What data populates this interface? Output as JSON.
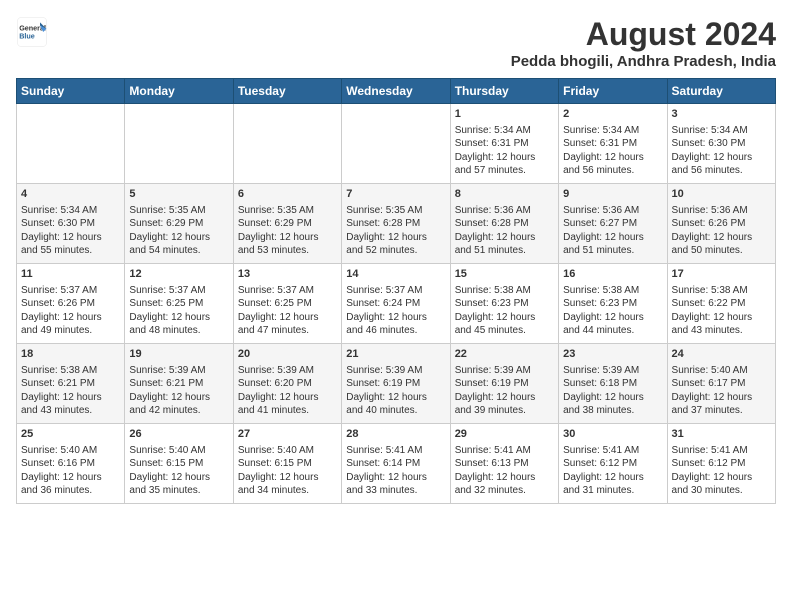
{
  "header": {
    "logo_line1": "General",
    "logo_line2": "Blue",
    "title": "August 2024",
    "subtitle": "Pedda bhogili, Andhra Pradesh, India"
  },
  "days_of_week": [
    "Sunday",
    "Monday",
    "Tuesday",
    "Wednesday",
    "Thursday",
    "Friday",
    "Saturday"
  ],
  "weeks": [
    [
      {
        "day": "",
        "info": ""
      },
      {
        "day": "",
        "info": ""
      },
      {
        "day": "",
        "info": ""
      },
      {
        "day": "",
        "info": ""
      },
      {
        "day": "1",
        "info": "Sunrise: 5:34 AM\nSunset: 6:31 PM\nDaylight: 12 hours\nand 57 minutes."
      },
      {
        "day": "2",
        "info": "Sunrise: 5:34 AM\nSunset: 6:31 PM\nDaylight: 12 hours\nand 56 minutes."
      },
      {
        "day": "3",
        "info": "Sunrise: 5:34 AM\nSunset: 6:30 PM\nDaylight: 12 hours\nand 56 minutes."
      }
    ],
    [
      {
        "day": "4",
        "info": "Sunrise: 5:34 AM\nSunset: 6:30 PM\nDaylight: 12 hours\nand 55 minutes."
      },
      {
        "day": "5",
        "info": "Sunrise: 5:35 AM\nSunset: 6:29 PM\nDaylight: 12 hours\nand 54 minutes."
      },
      {
        "day": "6",
        "info": "Sunrise: 5:35 AM\nSunset: 6:29 PM\nDaylight: 12 hours\nand 53 minutes."
      },
      {
        "day": "7",
        "info": "Sunrise: 5:35 AM\nSunset: 6:28 PM\nDaylight: 12 hours\nand 52 minutes."
      },
      {
        "day": "8",
        "info": "Sunrise: 5:36 AM\nSunset: 6:28 PM\nDaylight: 12 hours\nand 51 minutes."
      },
      {
        "day": "9",
        "info": "Sunrise: 5:36 AM\nSunset: 6:27 PM\nDaylight: 12 hours\nand 51 minutes."
      },
      {
        "day": "10",
        "info": "Sunrise: 5:36 AM\nSunset: 6:26 PM\nDaylight: 12 hours\nand 50 minutes."
      }
    ],
    [
      {
        "day": "11",
        "info": "Sunrise: 5:37 AM\nSunset: 6:26 PM\nDaylight: 12 hours\nand 49 minutes."
      },
      {
        "day": "12",
        "info": "Sunrise: 5:37 AM\nSunset: 6:25 PM\nDaylight: 12 hours\nand 48 minutes."
      },
      {
        "day": "13",
        "info": "Sunrise: 5:37 AM\nSunset: 6:25 PM\nDaylight: 12 hours\nand 47 minutes."
      },
      {
        "day": "14",
        "info": "Sunrise: 5:37 AM\nSunset: 6:24 PM\nDaylight: 12 hours\nand 46 minutes."
      },
      {
        "day": "15",
        "info": "Sunrise: 5:38 AM\nSunset: 6:23 PM\nDaylight: 12 hours\nand 45 minutes."
      },
      {
        "day": "16",
        "info": "Sunrise: 5:38 AM\nSunset: 6:23 PM\nDaylight: 12 hours\nand 44 minutes."
      },
      {
        "day": "17",
        "info": "Sunrise: 5:38 AM\nSunset: 6:22 PM\nDaylight: 12 hours\nand 43 minutes."
      }
    ],
    [
      {
        "day": "18",
        "info": "Sunrise: 5:38 AM\nSunset: 6:21 PM\nDaylight: 12 hours\nand 43 minutes."
      },
      {
        "day": "19",
        "info": "Sunrise: 5:39 AM\nSunset: 6:21 PM\nDaylight: 12 hours\nand 42 minutes."
      },
      {
        "day": "20",
        "info": "Sunrise: 5:39 AM\nSunset: 6:20 PM\nDaylight: 12 hours\nand 41 minutes."
      },
      {
        "day": "21",
        "info": "Sunrise: 5:39 AM\nSunset: 6:19 PM\nDaylight: 12 hours\nand 40 minutes."
      },
      {
        "day": "22",
        "info": "Sunrise: 5:39 AM\nSunset: 6:19 PM\nDaylight: 12 hours\nand 39 minutes."
      },
      {
        "day": "23",
        "info": "Sunrise: 5:39 AM\nSunset: 6:18 PM\nDaylight: 12 hours\nand 38 minutes."
      },
      {
        "day": "24",
        "info": "Sunrise: 5:40 AM\nSunset: 6:17 PM\nDaylight: 12 hours\nand 37 minutes."
      }
    ],
    [
      {
        "day": "25",
        "info": "Sunrise: 5:40 AM\nSunset: 6:16 PM\nDaylight: 12 hours\nand 36 minutes."
      },
      {
        "day": "26",
        "info": "Sunrise: 5:40 AM\nSunset: 6:15 PM\nDaylight: 12 hours\nand 35 minutes."
      },
      {
        "day": "27",
        "info": "Sunrise: 5:40 AM\nSunset: 6:15 PM\nDaylight: 12 hours\nand 34 minutes."
      },
      {
        "day": "28",
        "info": "Sunrise: 5:41 AM\nSunset: 6:14 PM\nDaylight: 12 hours\nand 33 minutes."
      },
      {
        "day": "29",
        "info": "Sunrise: 5:41 AM\nSunset: 6:13 PM\nDaylight: 12 hours\nand 32 minutes."
      },
      {
        "day": "30",
        "info": "Sunrise: 5:41 AM\nSunset: 6:12 PM\nDaylight: 12 hours\nand 31 minutes."
      },
      {
        "day": "31",
        "info": "Sunrise: 5:41 AM\nSunset: 6:12 PM\nDaylight: 12 hours\nand 30 minutes."
      }
    ]
  ]
}
